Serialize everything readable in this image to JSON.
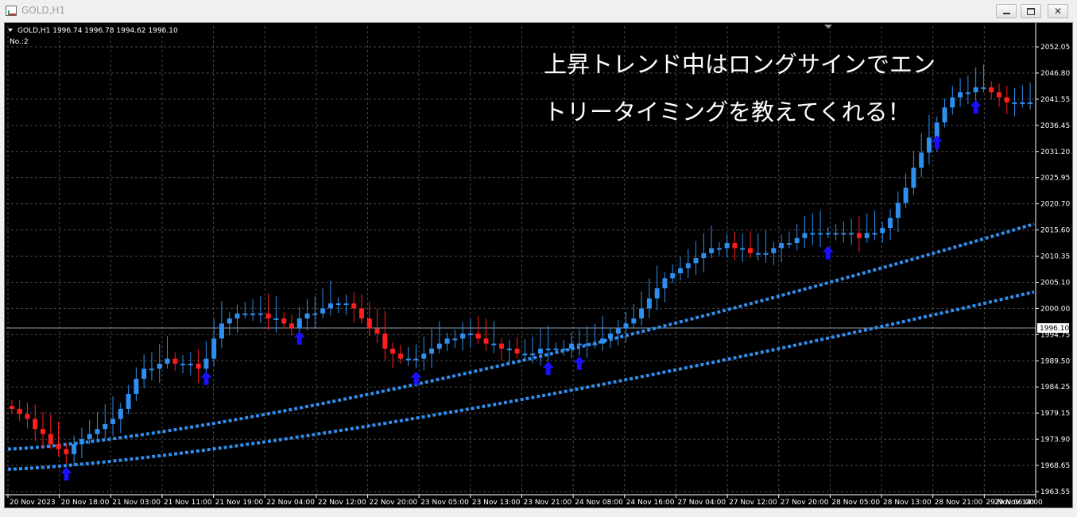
{
  "window": {
    "title": "GOLD,H1",
    "icon": "chart-app-icon",
    "buttons": [
      "minimize-icon",
      "maximize-icon",
      "close-icon"
    ]
  },
  "chart_header": {
    "symbol_line": "GOLD,H1  1996.74 1996.78 1994.62 1996.10",
    "indicator_label": "No.:2"
  },
  "annotation": {
    "line1": "上昇トレンド中はロングサインでエン",
    "line2": "トリータイミングを教えてくれる！"
  },
  "colors": {
    "background": "#000000",
    "grid": "#4a4a4a",
    "bull_candle": "#2f8fef",
    "bear_candle": "#ff1e1e",
    "ma_line": "#2f8fef",
    "arrow": "#1a10ff",
    "axis_text": "#ffffff"
  },
  "chart_data": {
    "type": "candlestick",
    "symbol": "GOLD",
    "timeframe": "H1",
    "current_price": "1996.10",
    "y_ticks": [
      "2052.05",
      "2046.80",
      "2041.55",
      "2036.45",
      "2031.20",
      "2025.95",
      "2020.70",
      "2015.60",
      "2010.35",
      "2005.10",
      "2000.00",
      "1994.75",
      "1989.50",
      "1984.25",
      "1979.15",
      "1973.90",
      "1968.65",
      "1963.55"
    ],
    "ylim": [
      1963.55,
      2052.05
    ],
    "x_ticks": [
      "20 Nov 2023",
      "20 Nov 18:00",
      "21 Nov 03:00",
      "21 Nov 11:00",
      "21 Nov 19:00",
      "22 Nov 04:00",
      "22 Nov 12:00",
      "22 Nov 20:00",
      "23 Nov 05:00",
      "23 Nov 13:00",
      "23 Nov 21:00",
      "24 Nov 08:00",
      "24 Nov 16:00",
      "27 Nov 04:00",
      "27 Nov 12:00",
      "27 Nov 20:00",
      "28 Nov 05:00",
      "28 Nov 13:00",
      "28 Nov 21:00",
      "29 Nov 06:00",
      "29 Nov 14:00"
    ],
    "closes": [
      1980,
      1979,
      1978,
      1976,
      1975,
      1973,
      1972,
      1971,
      1973,
      1974,
      1975,
      1976,
      1977,
      1978,
      1980,
      1983,
      1986,
      1988,
      1988,
      1989,
      1990,
      1989,
      1989,
      1989,
      1988,
      1990,
      1994,
      1997,
      1998,
      1999,
      1999,
      1999,
      1999,
      1998,
      1998,
      1997,
      1996,
      1998,
      1999,
      1999,
      2000,
      2001,
      2001,
      2001,
      2000,
      1998,
      1996,
      1995,
      1992,
      1991,
      1990,
      1990,
      1990,
      1991,
      1992,
      1993,
      1994,
      1994,
      1995,
      1995,
      1994,
      1993,
      1993,
      1992,
      1992,
      1991,
      1991,
      1991,
      1992,
      1992,
      1992,
      1992,
      1993,
      1993,
      1993,
      1993,
      1994,
      1995,
      1996,
      1997,
      1998,
      2000,
      2002,
      2004,
      2006,
      2007,
      2008,
      2009,
      2010,
      2011,
      2012,
      2012,
      2013,
      2012,
      2012,
      2011,
      2011,
      2011,
      2012,
      2013,
      2013,
      2014,
      2015,
      2015,
      2015,
      2015,
      2015,
      2015,
      2015,
      2014,
      2015,
      2015,
      2016,
      2018,
      2021,
      2024,
      2028,
      2031,
      2034,
      2037,
      2040,
      2042,
      2043,
      2043,
      2044,
      2044,
      2043,
      2042,
      2041,
      2041,
      2041,
      2041
    ],
    "series": [
      {
        "name": "",
        "start": 1972.0,
        "end": 2016.8
      },
      {
        "name": "",
        "start": 1968.0,
        "end": 2003.3
      }
    ],
    "signal_bar_indices": [
      7,
      25,
      37,
      52,
      69,
      73,
      105,
      119,
      124
    ],
    "grid": true
  }
}
